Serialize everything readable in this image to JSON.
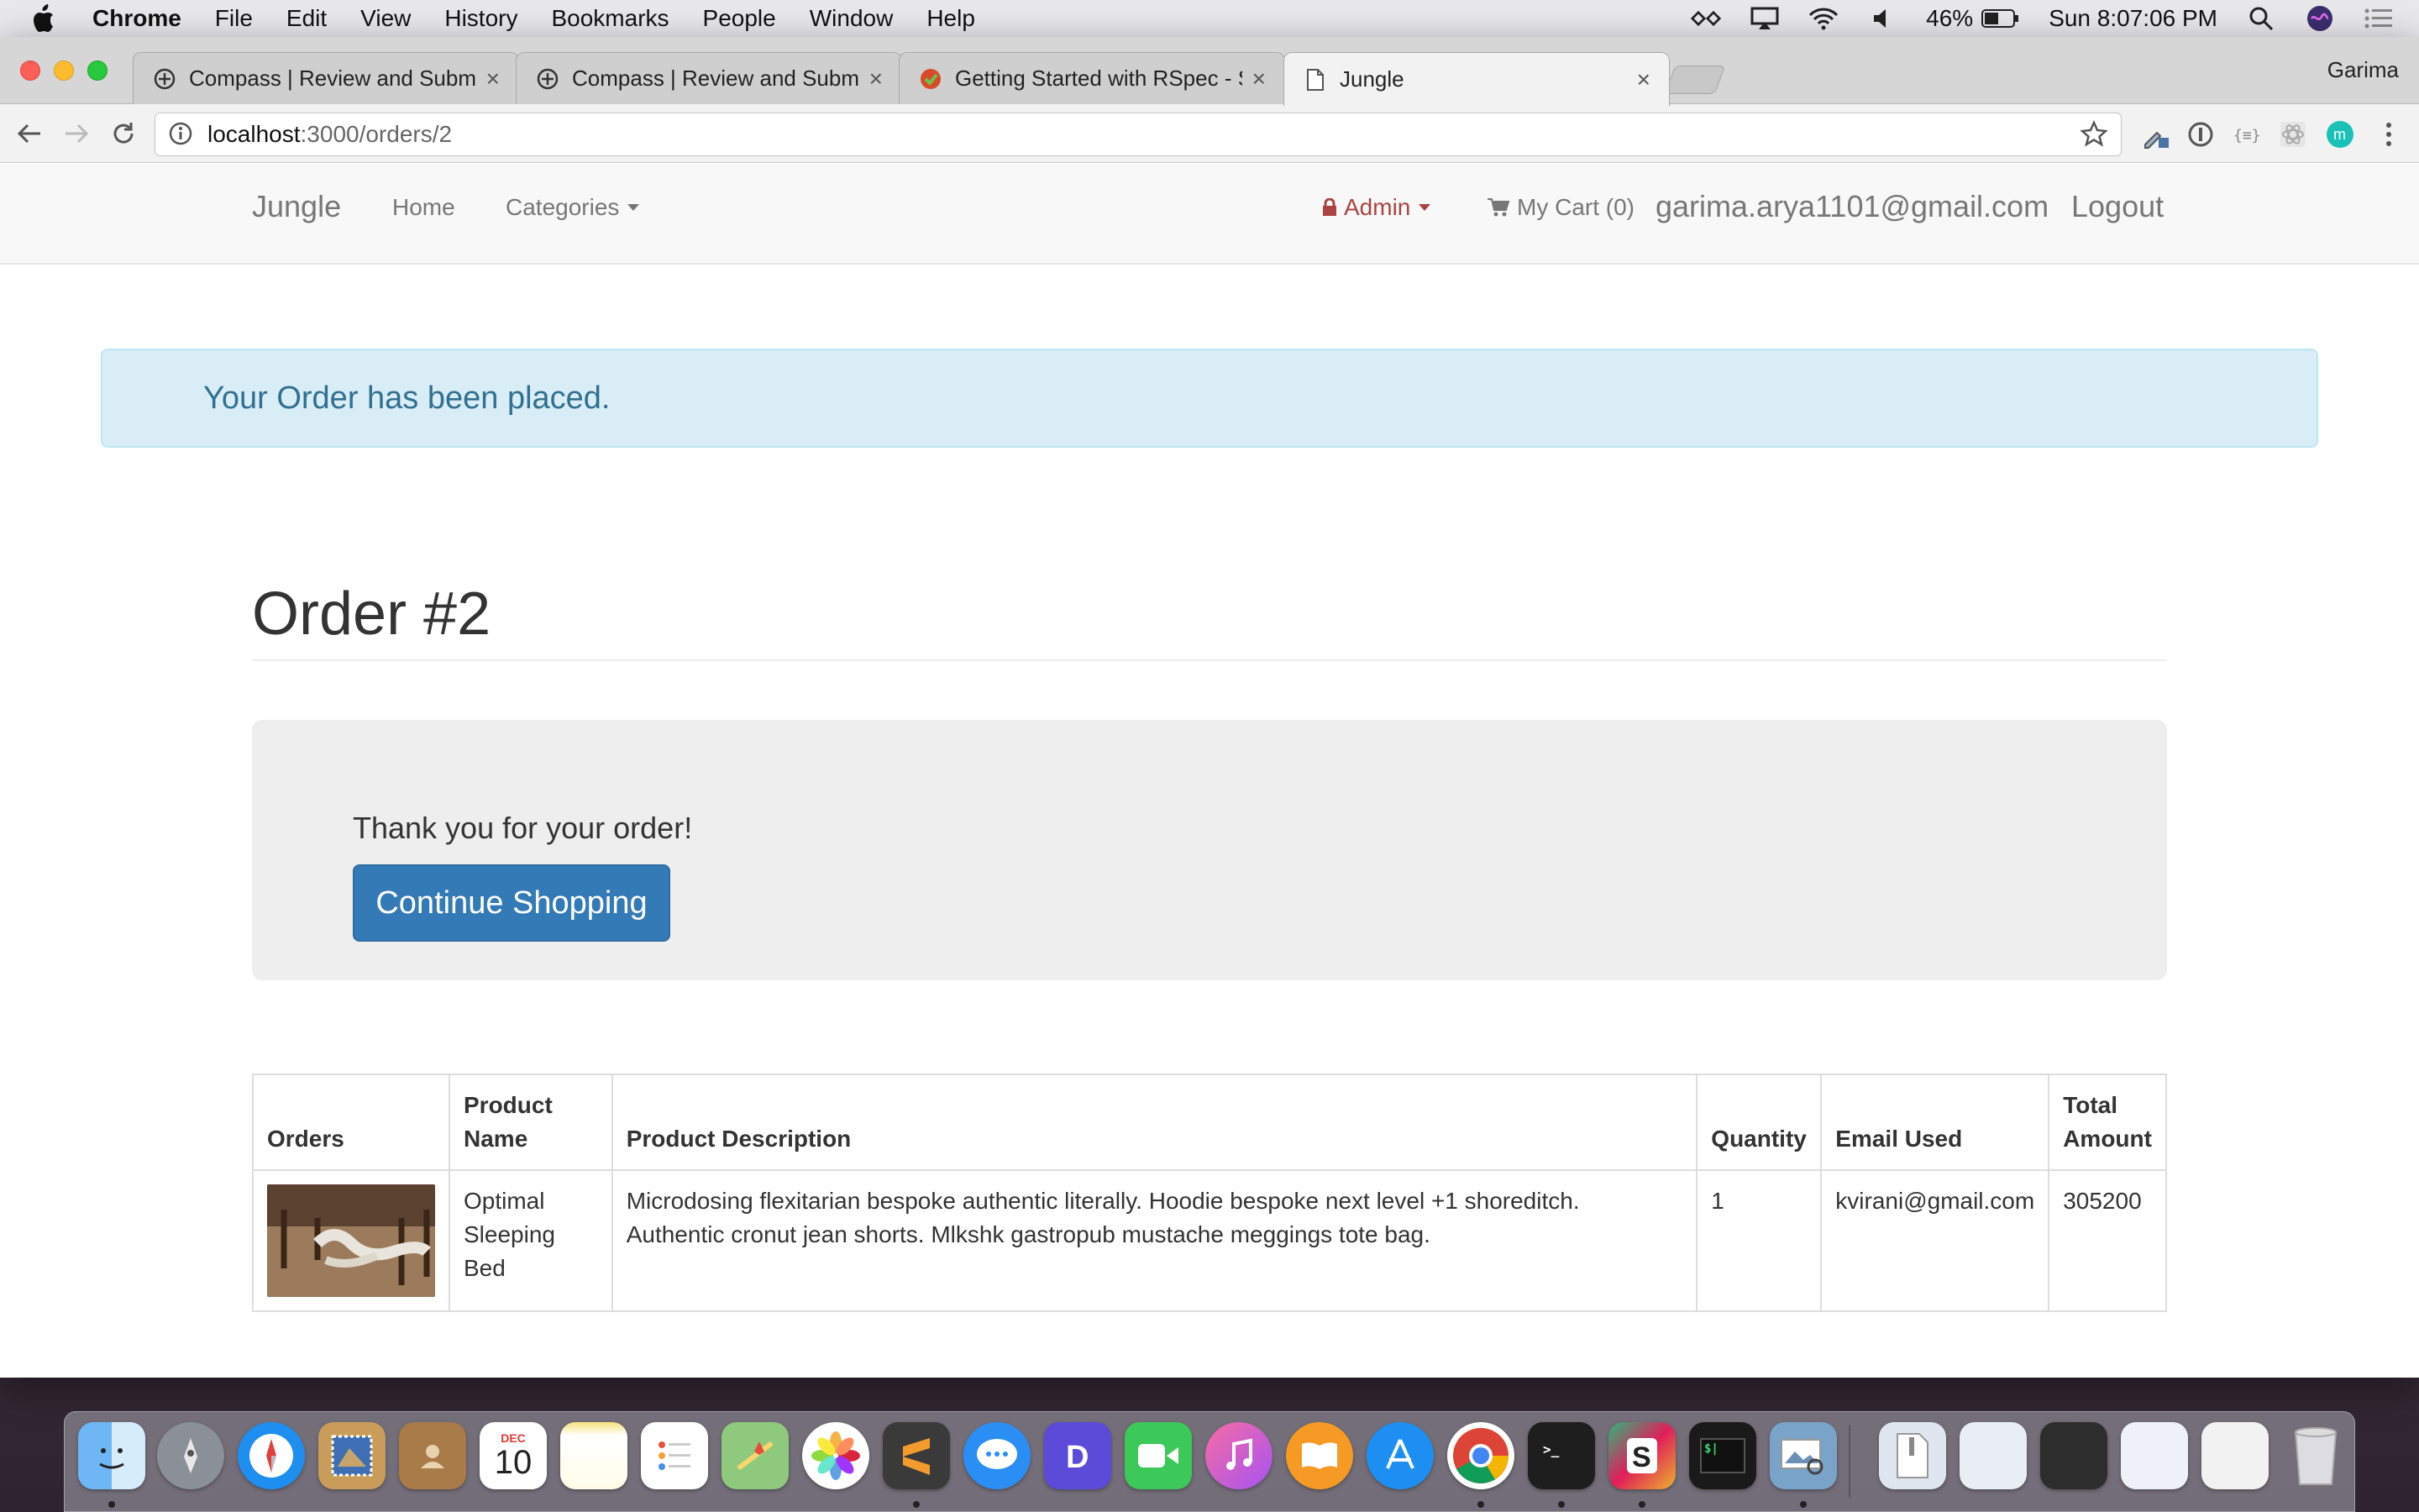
{
  "menubar": {
    "app_name": "Chrome",
    "items": [
      "File",
      "Edit",
      "View",
      "History",
      "Bookmarks",
      "People",
      "Window",
      "Help"
    ],
    "battery": "46%",
    "clock": "Sun 8:07:06 PM"
  },
  "browser": {
    "tabs": [
      {
        "title": "Compass | Review and Submit",
        "icon": "compass-icon"
      },
      {
        "title": "Compass | Review and Submit",
        "icon": "compass-icon"
      },
      {
        "title": "Getting Started with RSpec - S",
        "icon": "rspec-icon"
      },
      {
        "title": "Jungle",
        "icon": "page-icon"
      }
    ],
    "tab_close": "×",
    "profile": "Garima",
    "url_host": "localhost",
    "url_path": ":3000/orders/2"
  },
  "app": {
    "brand": "Jungle",
    "nav_home": "Home",
    "nav_categories": "Categories",
    "nav_admin": "Admin",
    "nav_cart": "My Cart (0)",
    "nav_user": "garima.arya1101@gmail.com",
    "nav_logout": "Logout"
  },
  "alert": {
    "message": "Your Order has been placed."
  },
  "order": {
    "title": "Order #2",
    "thanks": "Thank you for your order!",
    "continue_label": "Continue Shopping"
  },
  "table": {
    "headers": {
      "orders": "Orders",
      "product_name_1": "Product",
      "product_name_2": "Name",
      "description": "Product Description",
      "quantity": "Quantity",
      "email": "Email Used",
      "total_1": "Total",
      "total_2": "Amount"
    },
    "rows": [
      {
        "name_1": "Optimal",
        "name_2": "Sleeping",
        "name_3": "Bed",
        "description_1": "Microdosing flexitarian bespoke authentic literally. Hoodie bespoke next level +1 shoreditch.",
        "description_2": "Authentic cronut jean shorts. Mlkshk gastropub mustache meggings tote bag.",
        "quantity": "1",
        "email": "kvirani@gmail.com",
        "total": "305200"
      }
    ]
  },
  "dock": {
    "calendar_month": "DEC",
    "calendar_day": "10"
  },
  "colors": {
    "primary": "#337ab7",
    "alert_bg": "#d9edf7",
    "alert_text": "#31708f",
    "admin_red": "#a94442"
  }
}
